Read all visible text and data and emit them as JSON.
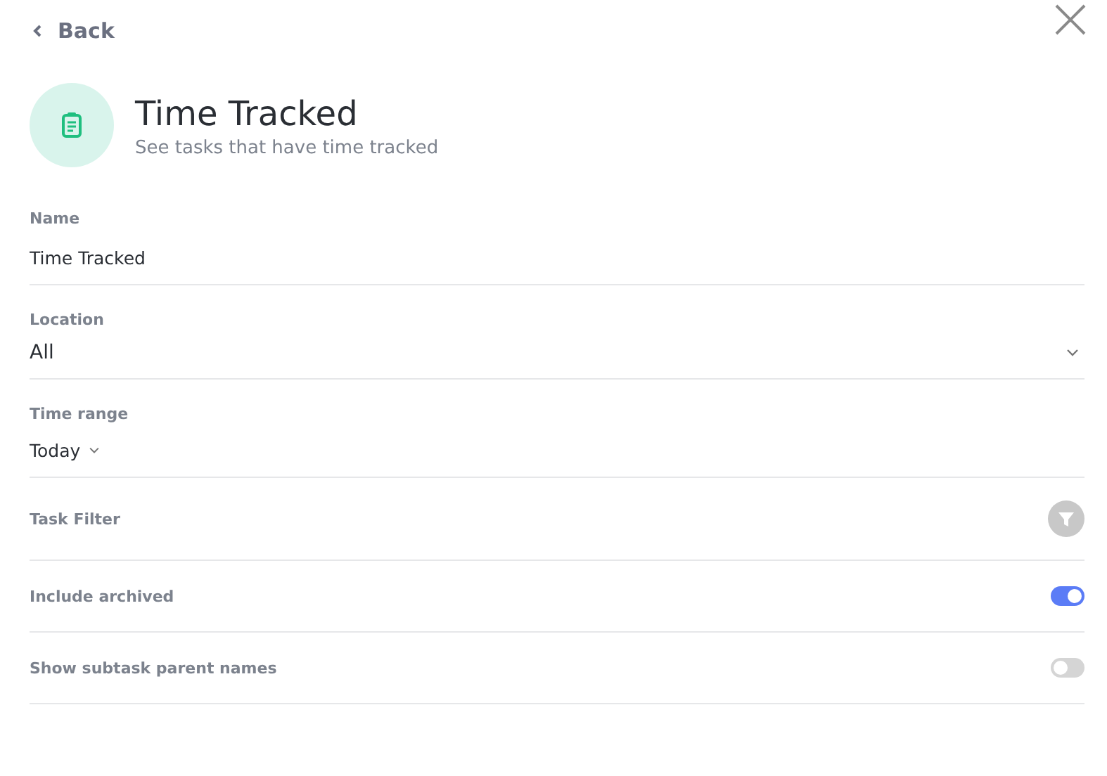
{
  "back": {
    "label": "Back"
  },
  "header": {
    "title": "Time Tracked",
    "subtitle": "See tasks that have time tracked"
  },
  "settings": [
    {
      "kind": "text",
      "label": "Name",
      "value": "Time Tracked"
    },
    {
      "kind": "select",
      "label": "Location",
      "value": "All"
    },
    {
      "kind": "inline-select",
      "label": "Time range",
      "value": "Today"
    },
    {
      "kind": "filter",
      "label": "Task Filter"
    },
    {
      "kind": "toggle",
      "label": "Include archived",
      "on": true
    },
    {
      "kind": "toggle",
      "label": "Show subtask parent names",
      "on": false
    }
  ]
}
